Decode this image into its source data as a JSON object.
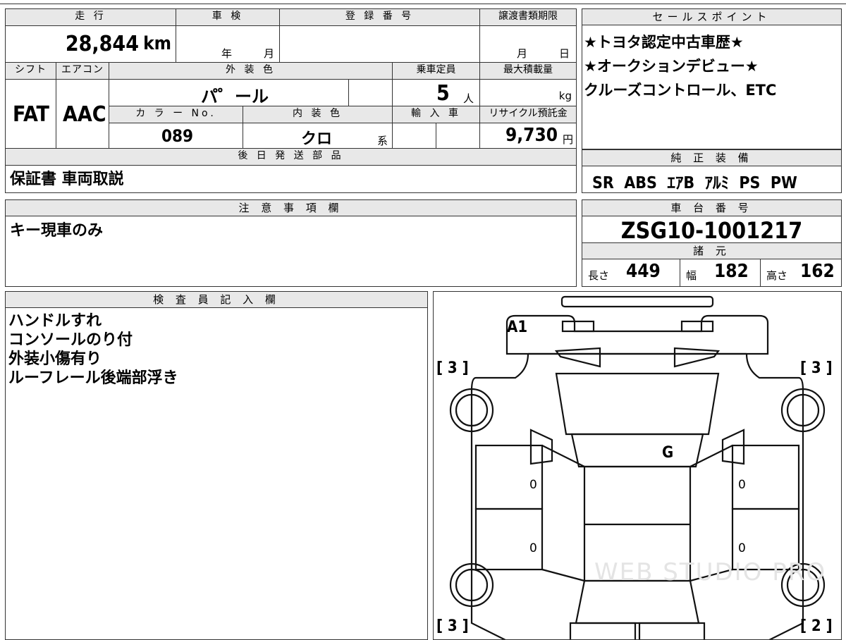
{
  "spec": {
    "mileage_label": "走 行",
    "mileage_value": "28,844",
    "mileage_unit": "km",
    "inspection_label": "車 検",
    "inspection_year": "年",
    "inspection_month": "月",
    "registration_label": "登 録 番 号",
    "transfer_label": "譲渡書類期限",
    "transfer_month": "月",
    "transfer_day": "日",
    "shift_label": "シフト",
    "shift_value": "FAT",
    "ac_label": "エアコン",
    "ac_value": "AAC",
    "exterior_label": "外 装 色",
    "exterior_value": "パ゜ール",
    "capacity_label": "乗車定員",
    "capacity_value": "5",
    "capacity_unit": "人",
    "load_label": "最大積載量",
    "load_unit": "kg",
    "color_no_label": "カ ラ ー No.",
    "color_no_value": "089",
    "interior_label": "内 装 色",
    "interior_value": "クロ",
    "interior_suffix": "系",
    "import_label": "輸 入 車",
    "recycle_label": "リサイクル預託金",
    "recycle_value": "9,730",
    "recycle_unit": "円",
    "later_parts_label": "後 日 発 送 部 品",
    "later_parts_value": "保証書 車両取説"
  },
  "sales": {
    "label": "セールスポイント",
    "lines": [
      "★トヨタ認定中古車歴★",
      "★オークションデビュー★",
      "クルーズコントロール、ETC"
    ]
  },
  "equipment": {
    "label": "純 正 装 備",
    "value": "SR  ABS  ｴｱB  ｱﾙﾐ  PS  PW"
  },
  "notes": {
    "label": "注 意 事 項 欄",
    "value": "キー現車のみ"
  },
  "chassis": {
    "label": "車 台 番 号",
    "value": "ZSG10-1001217",
    "dims_label": "諸 元",
    "length_label": "長さ",
    "length_value": "449",
    "width_label": "幅",
    "width_value": "182",
    "height_label": "高さ",
    "height_value": "162"
  },
  "inspector": {
    "label": "検 査 員 記 入 欄",
    "lines": [
      "ハンドルすれ",
      "コンソールのり付",
      "外装小傷有り",
      "ルーフレール後端部浮き"
    ]
  },
  "diagram": {
    "mark_a1": "A1",
    "mark_g": "G",
    "tire_fl": "[ 3 ]",
    "tire_fr": "[ 3 ]",
    "tire_rl": "[ 3 ]",
    "tire_rr": "[ 2 ]",
    "door_marks": [
      "0",
      "0",
      "0",
      "0"
    ],
    "watermark": "WEB STUDIO PRO"
  }
}
